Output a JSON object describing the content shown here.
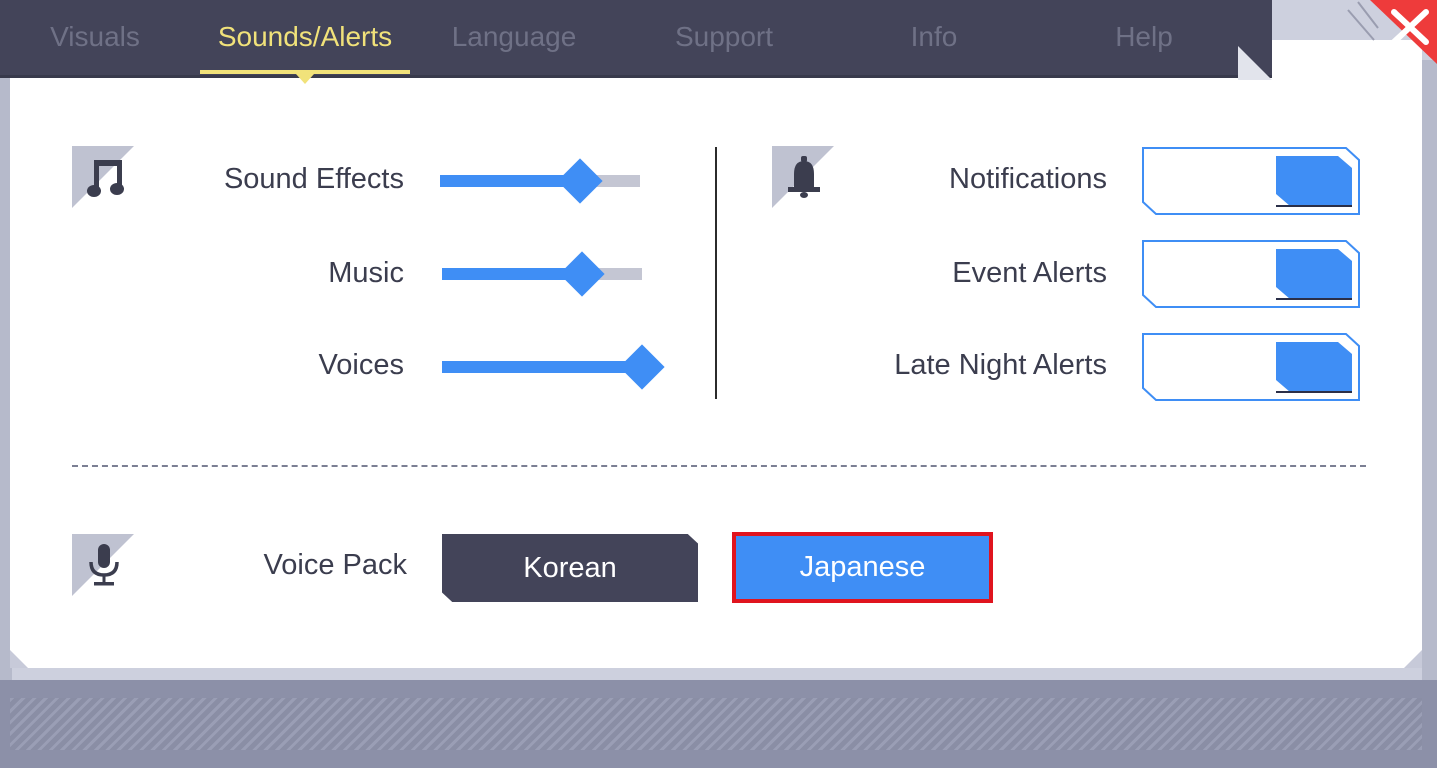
{
  "tabs": [
    {
      "label": "Visuals",
      "active": false
    },
    {
      "label": "Sounds/Alerts",
      "active": true
    },
    {
      "label": "Language",
      "active": false
    },
    {
      "label": "Support",
      "active": false
    },
    {
      "label": "Info",
      "active": false
    },
    {
      "label": "Help",
      "active": false
    }
  ],
  "sound": {
    "icon": "music-note-icon",
    "sliders": [
      {
        "label": "Sound Effects",
        "value_percent": 70
      },
      {
        "label": "Music",
        "value_percent": 70
      },
      {
        "label": "Voices",
        "value_percent": 100
      }
    ]
  },
  "alerts": {
    "icon": "bell-icon",
    "toggles": [
      {
        "label": "Notifications",
        "on": true
      },
      {
        "label": "Event Alerts",
        "on": true
      },
      {
        "label": "Late Night Alerts",
        "on": true
      }
    ]
  },
  "voice_pack": {
    "icon": "microphone-icon",
    "label": "Voice Pack",
    "options": [
      "Korean",
      "Japanese"
    ],
    "selected": "Japanese"
  },
  "colors": {
    "accent_blue": "#3f8ef5",
    "tab_active": "#f1e27a",
    "tab_bar": "#434459",
    "close_red": "#ee3b3b",
    "selection_outline": "#e0141e"
  }
}
